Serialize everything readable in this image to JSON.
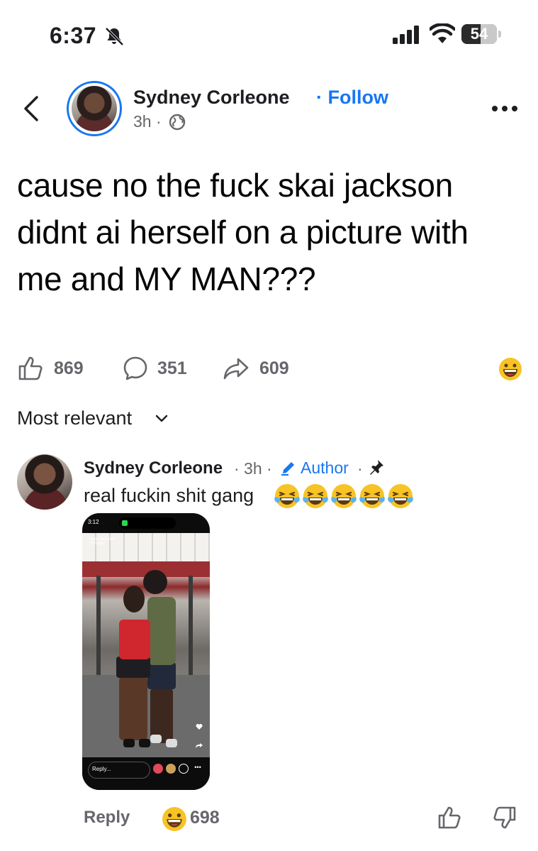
{
  "status_bar": {
    "time": "6:37",
    "battery": "54",
    "battery_percent": 0.54
  },
  "post": {
    "author": "Sydney Corleone",
    "follow_label": "· Follow",
    "time": "3h ·",
    "text": "cause no the fuck skai jackson didnt ai herself on a picture with me and MY MAN???"
  },
  "actions": {
    "likes": "869",
    "comments": "351",
    "shares": "609"
  },
  "sort_label": "Most relevant",
  "comment": {
    "author": "Sydney Corleone",
    "meta": "· 3h ·",
    "badge": "Author",
    "dot": "·",
    "text": "real fuckin shit gang",
    "emoji_count": 5
  },
  "screenshot_image": {
    "time": "3:12",
    "story_user": "Skai Jackson",
    "story_age": "20h ago",
    "reply_placeholder": "Reply..."
  },
  "comment_footer": {
    "reply_label": "Reply",
    "reaction_count": "698"
  },
  "colors": {
    "accent": "#1877f2",
    "text": "#1c1e21",
    "muted": "#65676b"
  }
}
